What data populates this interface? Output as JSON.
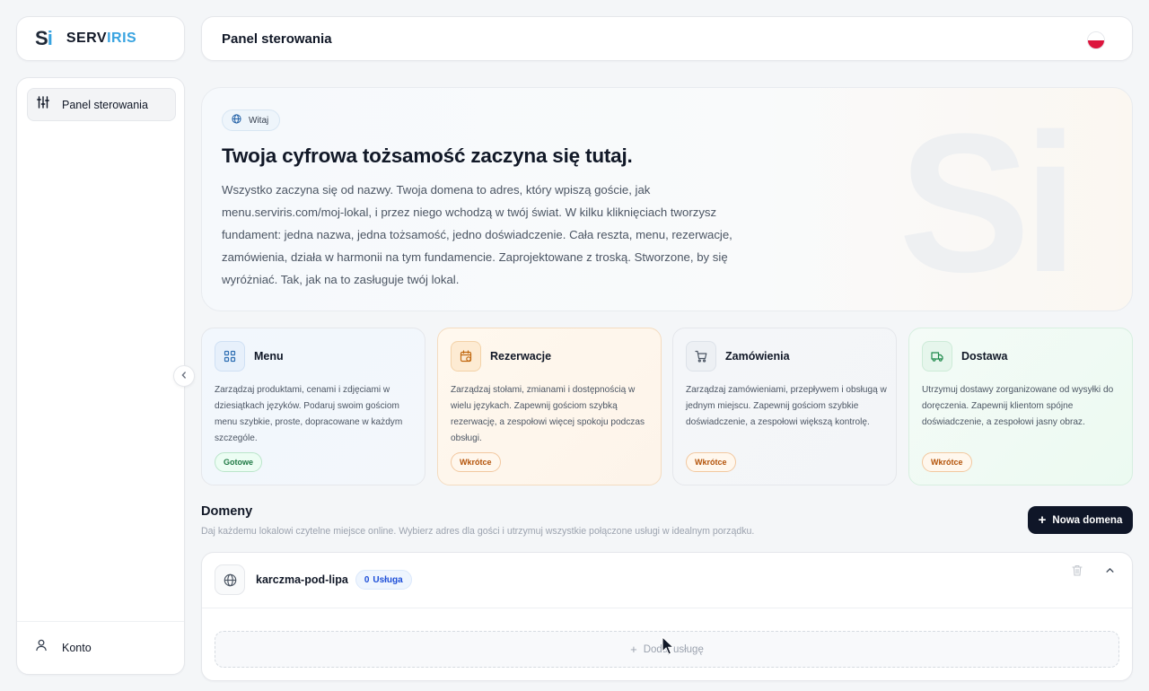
{
  "brand": {
    "mark_s": "S",
    "mark_i": "i",
    "name_a": "SERV",
    "name_b": "IRIS"
  },
  "header": {
    "title": "Panel sterowania",
    "language_flag": "flag-pl-icon"
  },
  "sidebar": {
    "items": [
      {
        "label": "Panel sterowania",
        "icon": "sliders-icon"
      }
    ],
    "account": {
      "label": "Konto",
      "icon": "user-icon"
    }
  },
  "hero": {
    "badge": "Witaj",
    "title": "Twoja cyfrowa tożsamość zaczyna się tutaj.",
    "text": "Wszystko zaczyna się od nazwy. Twoja domena to adres, który wpiszą goście, jak menu.serviris.com/moj-lokal, i przez niego wchodzą w twój świat. W kilku kliknięciach tworzysz fundament: jedna nazwa, jedna tożsamość, jedno doświadczenie. Cała reszta, menu, rezerwacje, zamówienia, działa w harmonii na tym fundamencie. Zaprojektowane z troską. Stworzone, by się wyróżniać. Tak, jak na to zasługuje twój lokal.",
    "watermark": "Si"
  },
  "features": [
    {
      "title": "Menu",
      "icon": "grid-icon",
      "desc": "Zarządzaj produktami, cenami i zdjęciami w dziesiątkach języków. Podaruj swoim gościom menu szybkie, proste, dopracowane w każdym szczególe.",
      "badge": "Gotowe"
    },
    {
      "title": "Rezerwacje",
      "icon": "calendar-icon",
      "desc": "Zarządzaj stołami, zmianami i dostępnością w wielu językach. Zapewnij gościom szybką rezerwację, a zespołowi więcej spokoju podczas obsługi.",
      "badge": "Wkrótce"
    },
    {
      "title": "Zamówienia",
      "icon": "cart-icon",
      "desc": "Zarządzaj zamówieniami, przepływem i obsługą w jednym miejscu. Zapewnij gościom szybkie doświadczenie, a zespołowi większą kontrolę.",
      "badge": "Wkrótce"
    },
    {
      "title": "Dostawa",
      "icon": "truck-icon",
      "desc": "Utrzymuj dostawy zorganizowane od wysyłki do doręczenia. Zapewnij klientom spójne doświadczenie, a zespołowi jasny obraz.",
      "badge": "Wkrótce"
    }
  ],
  "domains": {
    "title": "Domeny",
    "subtitle": "Daj każdemu lokalowi czytelne miejsce online. Wybierz adres dla gości i utrzymuj wszystkie połączone usługi w idealnym porządku.",
    "new_button": "Nowa domena",
    "list": [
      {
        "name": "karczma-pod-lipa",
        "count": "0",
        "count_label": "Usługa",
        "add_label": "Dodaj usługę"
      }
    ]
  },
  "colors": {
    "brand_blue": "#38a3e0",
    "primary_dark": "#0f1628",
    "flag_red": "#dc143c"
  }
}
